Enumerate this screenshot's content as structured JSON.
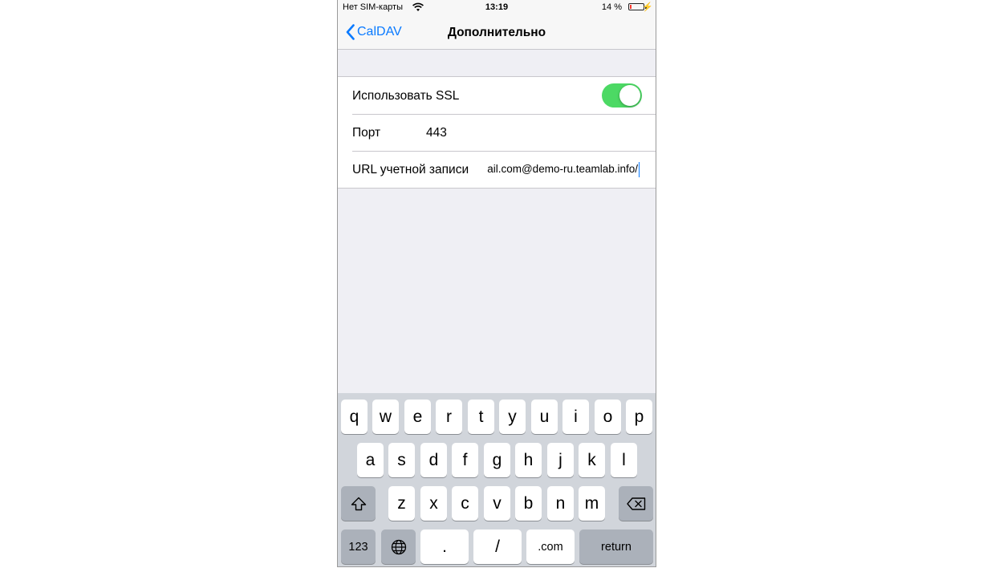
{
  "status_bar": {
    "carrier": "Нет SIM-карты",
    "time": "13:19",
    "battery_percent": "14 %",
    "battery_level": 0.14,
    "icons": [
      "wifi-icon",
      "battery-icon",
      "charging-bolt-icon"
    ]
  },
  "nav": {
    "back_label": "CalDAV",
    "title": "Дополнительно",
    "accent_color": "#0a7aff"
  },
  "settings": {
    "use_ssl_label": "Использовать SSL",
    "use_ssl_on": true,
    "toggle_color": "#4cd964",
    "port_label": "Порт",
    "port_value": "443",
    "account_url_label": "URL учетной записи",
    "account_url_value": "ail.com@demo-ru.teamlab.info/"
  },
  "keyboard": {
    "row1": [
      "q",
      "w",
      "e",
      "r",
      "t",
      "y",
      "u",
      "i",
      "o",
      "p"
    ],
    "row2": [
      "a",
      "s",
      "d",
      "f",
      "g",
      "h",
      "j",
      "k",
      "l"
    ],
    "row3": [
      "z",
      "x",
      "c",
      "v",
      "b",
      "n",
      "m"
    ],
    "shift_icon": "shift-icon",
    "delete_icon": "delete-icon",
    "numbers_label": "123",
    "globe_icon": "globe-icon",
    "dot_label": ".",
    "slash_label": "/",
    "dotcom_label": ".com",
    "return_label": "return"
  }
}
